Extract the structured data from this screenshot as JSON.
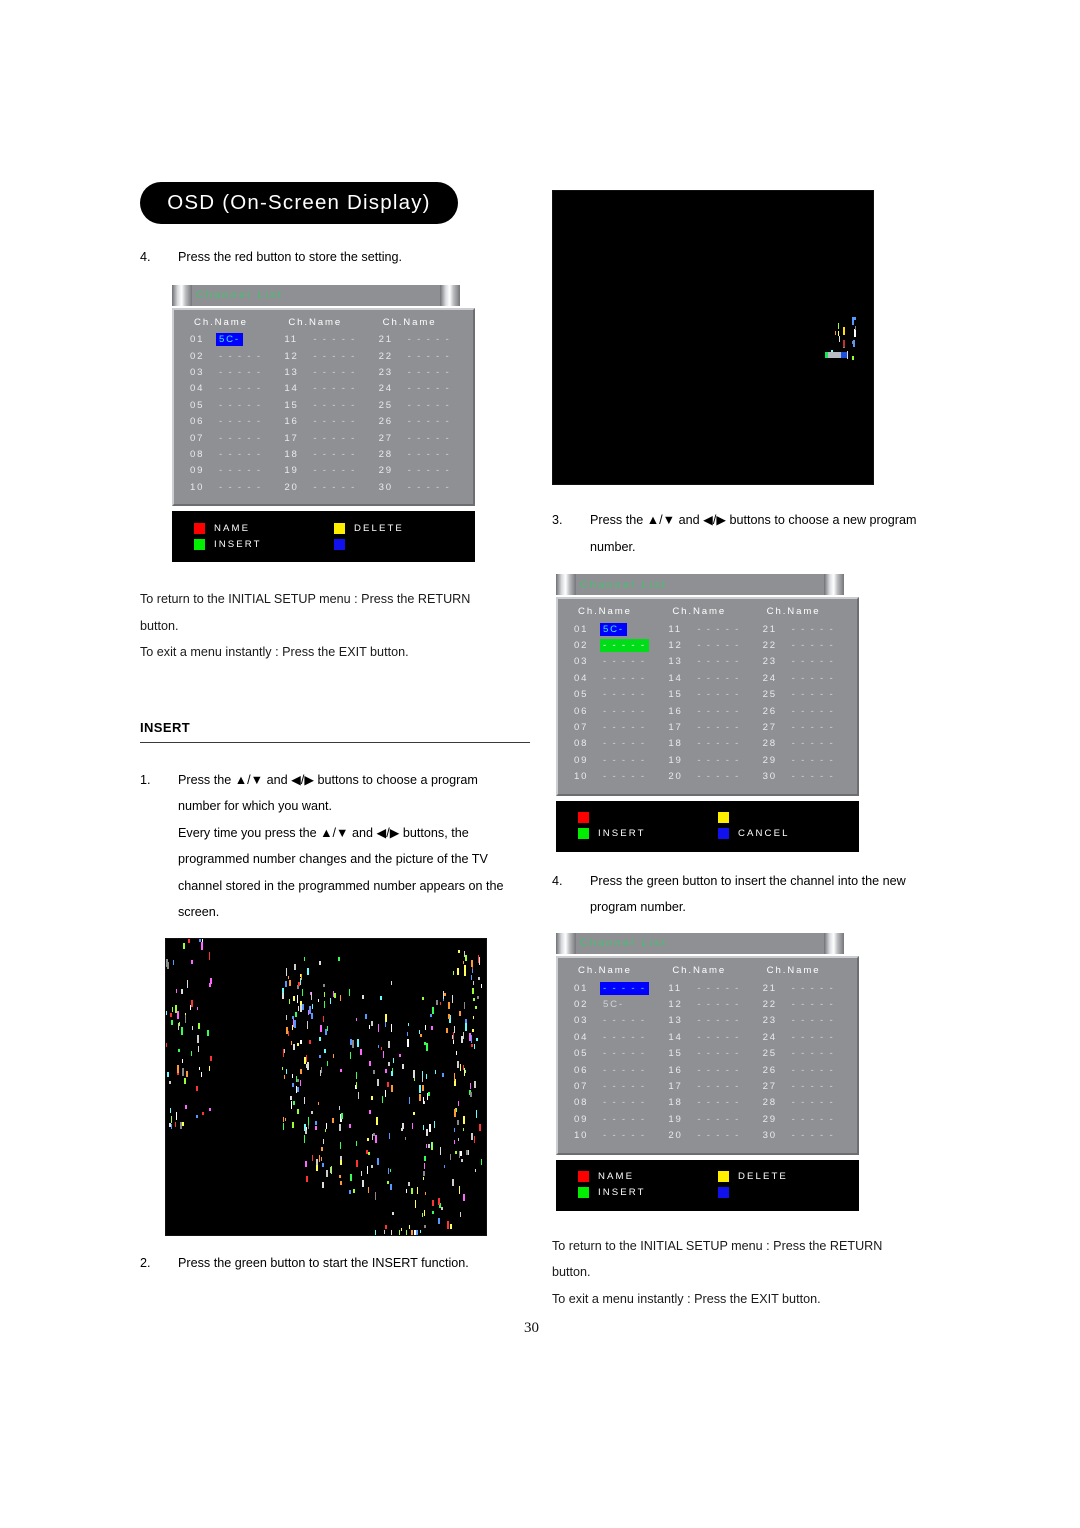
{
  "header": {
    "title": "OSD (On-Screen Display)"
  },
  "page": {
    "number": "30"
  },
  "left": {
    "step4": {
      "num": "4.",
      "text": "Press the red button to store the setting."
    },
    "panel1": {
      "title": "Channel List",
      "col_header": "Ch.Name",
      "columns": [
        {
          "rows": [
            {
              "num": "01",
              "name": "5C-",
              "state": "blue"
            },
            {
              "num": "02",
              "name": "- - - - -",
              "state": "normal"
            },
            {
              "num": "03",
              "name": "- - - - -",
              "state": "normal"
            },
            {
              "num": "04",
              "name": "- - - - -",
              "state": "normal"
            },
            {
              "num": "05",
              "name": "- - - - -",
              "state": "normal"
            },
            {
              "num": "06",
              "name": "- - - - -",
              "state": "normal"
            },
            {
              "num": "07",
              "name": "- - - - -",
              "state": "normal"
            },
            {
              "num": "08",
              "name": "- - - - -",
              "state": "normal"
            },
            {
              "num": "09",
              "name": "- - - - -",
              "state": "normal"
            },
            {
              "num": "10",
              "name": "- - - - -",
              "state": "normal"
            }
          ]
        },
        {
          "rows": [
            {
              "num": "11",
              "name": "- - - - -",
              "state": "normal"
            },
            {
              "num": "12",
              "name": "- - - - -",
              "state": "normal"
            },
            {
              "num": "13",
              "name": "- - - - -",
              "state": "normal"
            },
            {
              "num": "14",
              "name": "- - - - -",
              "state": "normal"
            },
            {
              "num": "15",
              "name": "- - - - -",
              "state": "normal"
            },
            {
              "num": "16",
              "name": "- - - - -",
              "state": "normal"
            },
            {
              "num": "17",
              "name": "- - - - -",
              "state": "normal"
            },
            {
              "num": "18",
              "name": "- - - - -",
              "state": "normal"
            },
            {
              "num": "19",
              "name": "- - - - -",
              "state": "normal"
            },
            {
              "num": "20",
              "name": "- - - - -",
              "state": "normal"
            }
          ]
        },
        {
          "rows": [
            {
              "num": "21",
              "name": "- - - - -",
              "state": "normal"
            },
            {
              "num": "22",
              "name": "- - - - -",
              "state": "normal"
            },
            {
              "num": "23",
              "name": "- - - - -",
              "state": "normal"
            },
            {
              "num": "24",
              "name": "- - - - -",
              "state": "normal"
            },
            {
              "num": "25",
              "name": "- - - - -",
              "state": "normal"
            },
            {
              "num": "26",
              "name": "- - - - -",
              "state": "normal"
            },
            {
              "num": "27",
              "name": "- - - - -",
              "state": "normal"
            },
            {
              "num": "28",
              "name": "- - - - -",
              "state": "normal"
            },
            {
              "num": "29",
              "name": "- - - - -",
              "state": "normal"
            },
            {
              "num": "30",
              "name": "- - - - -",
              "state": "normal"
            }
          ]
        }
      ],
      "buttons": [
        {
          "color": "red",
          "label": "NAME"
        },
        {
          "color": "yellow",
          "label": "DELETE"
        },
        {
          "color": "green",
          "label": "INSERT"
        },
        {
          "color": "blue",
          "label": ""
        }
      ]
    },
    "note1": "To return to the INITIAL SETUP menu : Press the RETURN",
    "note1b": "button.",
    "note2": "To exit a menu instantly : Press the EXIT button.",
    "section": "INSERT",
    "step1": {
      "num": "1.",
      "line1_a": "Press the ",
      "line1_arrows1": "▲/▼",
      "line1_b": " and ",
      "line1_arrows2": "◀/▶",
      "line1_c": " buttons to choose a program",
      "line2": "number for which you want.",
      "line3_a": "Every time you press the ",
      "line3_b": " and ",
      "line3_c": " buttons, the",
      "line4": "programmed number changes and the picture of the TV",
      "line5": "channel stored in the programmed number appears on the",
      "line6": "screen."
    },
    "step2": {
      "num": "2.",
      "text": "Press the green button to start the INSERT function."
    }
  },
  "right": {
    "step3": {
      "num": "3.",
      "line1_a": "Press the ",
      "line1_arrows1": "▲/▼",
      "line1_b": " and ",
      "line1_arrows2": "◀/▶",
      "line1_c": " buttons to choose a new program",
      "line2": "number."
    },
    "panel2": {
      "title": "Channel List",
      "col_header": "Ch.Name",
      "columns": [
        {
          "rows": [
            {
              "num": "01",
              "name": "5C-",
              "state": "blue"
            },
            {
              "num": "02",
              "name": "- - - - -",
              "state": "green"
            },
            {
              "num": "03",
              "name": "- - - - -",
              "state": "normal"
            },
            {
              "num": "04",
              "name": "- - - - -",
              "state": "normal"
            },
            {
              "num": "05",
              "name": "- - - - -",
              "state": "normal"
            },
            {
              "num": "06",
              "name": "- - - - -",
              "state": "normal"
            },
            {
              "num": "07",
              "name": "- - - - -",
              "state": "normal"
            },
            {
              "num": "08",
              "name": "- - - - -",
              "state": "normal"
            },
            {
              "num": "09",
              "name": "- - - - -",
              "state": "normal"
            },
            {
              "num": "10",
              "name": "- - - - -",
              "state": "normal"
            }
          ]
        },
        {
          "rows": [
            {
              "num": "11",
              "name": "- - - - -",
              "state": "normal"
            },
            {
              "num": "12",
              "name": "- - - - -",
              "state": "normal"
            },
            {
              "num": "13",
              "name": "- - - - -",
              "state": "normal"
            },
            {
              "num": "14",
              "name": "- - - - -",
              "state": "normal"
            },
            {
              "num": "15",
              "name": "- - - - -",
              "state": "normal"
            },
            {
              "num": "16",
              "name": "- - - - -",
              "state": "normal"
            },
            {
              "num": "17",
              "name": "- - - - -",
              "state": "normal"
            },
            {
              "num": "18",
              "name": "- - - - -",
              "state": "normal"
            },
            {
              "num": "19",
              "name": "- - - - -",
              "state": "normal"
            },
            {
              "num": "20",
              "name": "- - - - -",
              "state": "normal"
            }
          ]
        },
        {
          "rows": [
            {
              "num": "21",
              "name": "- - - - -",
              "state": "normal"
            },
            {
              "num": "22",
              "name": "- - - - -",
              "state": "normal"
            },
            {
              "num": "23",
              "name": "- - - - -",
              "state": "normal"
            },
            {
              "num": "24",
              "name": "- - - - -",
              "state": "normal"
            },
            {
              "num": "25",
              "name": "- - - - -",
              "state": "normal"
            },
            {
              "num": "26",
              "name": "- - - - -",
              "state": "normal"
            },
            {
              "num": "27",
              "name": "- - - - -",
              "state": "normal"
            },
            {
              "num": "28",
              "name": "- - - - -",
              "state": "normal"
            },
            {
              "num": "29",
              "name": "- - - - -",
              "state": "normal"
            },
            {
              "num": "30",
              "name": "- - - - -",
              "state": "normal"
            }
          ]
        }
      ],
      "buttons": [
        {
          "color": "red",
          "label": ""
        },
        {
          "color": "yellow",
          "label": ""
        },
        {
          "color": "green",
          "label": "INSERT"
        },
        {
          "color": "blue",
          "label": "CANCEL"
        }
      ]
    },
    "step4": {
      "num": "4.",
      "line1": "Press the green button to insert the channel into the new",
      "line2": "program number."
    },
    "panel3": {
      "title": "Channel List",
      "col_header": "Ch.Name",
      "columns": [
        {
          "rows": [
            {
              "num": "01",
              "name": "- - - - -",
              "state": "blue"
            },
            {
              "num": "02",
              "name": "5C-",
              "state": "normal"
            },
            {
              "num": "03",
              "name": "- - - - -",
              "state": "normal"
            },
            {
              "num": "04",
              "name": "- - - - -",
              "state": "normal"
            },
            {
              "num": "05",
              "name": "- - - - -",
              "state": "normal"
            },
            {
              "num": "06",
              "name": "- - - - -",
              "state": "normal"
            },
            {
              "num": "07",
              "name": "- - - - -",
              "state": "normal"
            },
            {
              "num": "08",
              "name": "- - - - -",
              "state": "normal"
            },
            {
              "num": "09",
              "name": "- - - - -",
              "state": "normal"
            },
            {
              "num": "10",
              "name": "- - - - -",
              "state": "normal"
            }
          ]
        },
        {
          "rows": [
            {
              "num": "11",
              "name": "- - - - -",
              "state": "normal"
            },
            {
              "num": "12",
              "name": "- - - - -",
              "state": "normal"
            },
            {
              "num": "13",
              "name": "- - - - -",
              "state": "normal"
            },
            {
              "num": "14",
              "name": "- - - - -",
              "state": "normal"
            },
            {
              "num": "15",
              "name": "- - - - -",
              "state": "normal"
            },
            {
              "num": "16",
              "name": "- - - - -",
              "state": "normal"
            },
            {
              "num": "17",
              "name": "- - - - -",
              "state": "normal"
            },
            {
              "num": "18",
              "name": "- - - - -",
              "state": "normal"
            },
            {
              "num": "19",
              "name": "- - - - -",
              "state": "normal"
            },
            {
              "num": "20",
              "name": "- - - - -",
              "state": "normal"
            }
          ]
        },
        {
          "rows": [
            {
              "num": "21",
              "name": "- - - - -",
              "state": "normal"
            },
            {
              "num": "22",
              "name": "- - - - -",
              "state": "normal"
            },
            {
              "num": "23",
              "name": "- - - - -",
              "state": "normal"
            },
            {
              "num": "24",
              "name": "- - - - -",
              "state": "normal"
            },
            {
              "num": "25",
              "name": "- - - - -",
              "state": "normal"
            },
            {
              "num": "26",
              "name": "- - - - -",
              "state": "normal"
            },
            {
              "num": "27",
              "name": "- - - - -",
              "state": "normal"
            },
            {
              "num": "28",
              "name": "- - - - -",
              "state": "normal"
            },
            {
              "num": "29",
              "name": "- - - - -",
              "state": "normal"
            },
            {
              "num": "30",
              "name": "- - - - -",
              "state": "normal"
            }
          ]
        }
      ],
      "buttons": [
        {
          "color": "red",
          "label": "NAME"
        },
        {
          "color": "yellow",
          "label": "DELETE"
        },
        {
          "color": "green",
          "label": "INSERT"
        },
        {
          "color": "blue",
          "label": ""
        }
      ]
    },
    "note1": "To return to the INITIAL SETUP menu : Press the RETURN",
    "note1b": "button.",
    "note2": "To exit a menu instantly : Press the EXIT button."
  }
}
